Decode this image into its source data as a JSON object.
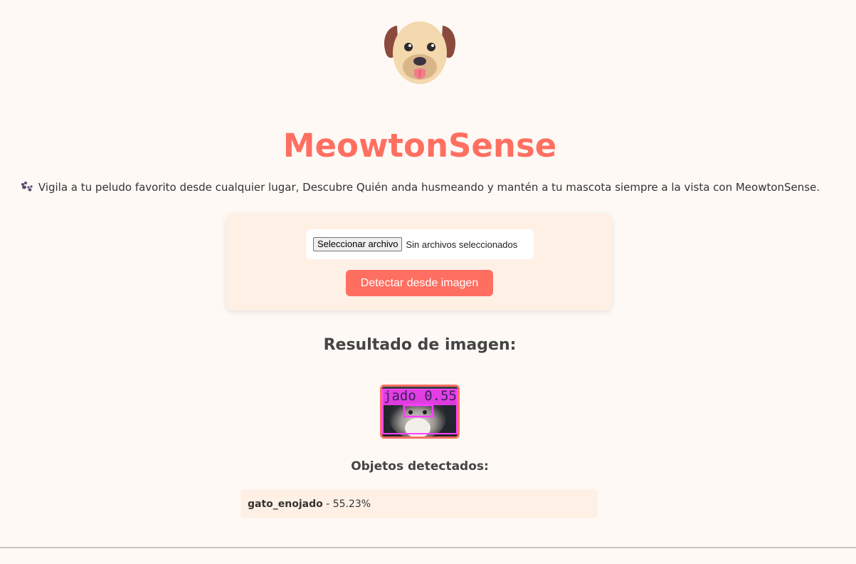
{
  "header": {
    "logo_icon": "puppy-face-icon",
    "title": "MeowtonSense",
    "tagline_icon": "paw-prints-icon",
    "tagline": "Vigila a tu peludo favorito desde cualquier lugar, Descubre Quién anda husmeando y mantén a tu mascota siempre a la vista con MeowtonSense."
  },
  "upload": {
    "file_button_label": "Seleccionar archivo",
    "file_status": "Sin archivos seleccionados",
    "detect_button_label": "Detectar desde imagen"
  },
  "result": {
    "heading": "Resultado de imagen:",
    "image_overlay_label": "jado 0.55",
    "objects_heading": "Objetos detectados:",
    "detections": [
      {
        "label": "gato_enojado",
        "separator": " - ",
        "confidence": "55.23%"
      }
    ]
  },
  "colors": {
    "accent": "#ff6f61",
    "page_background": "#fef9f5",
    "card_background": "#fff0e6",
    "detection_box": "#ff40ff"
  }
}
